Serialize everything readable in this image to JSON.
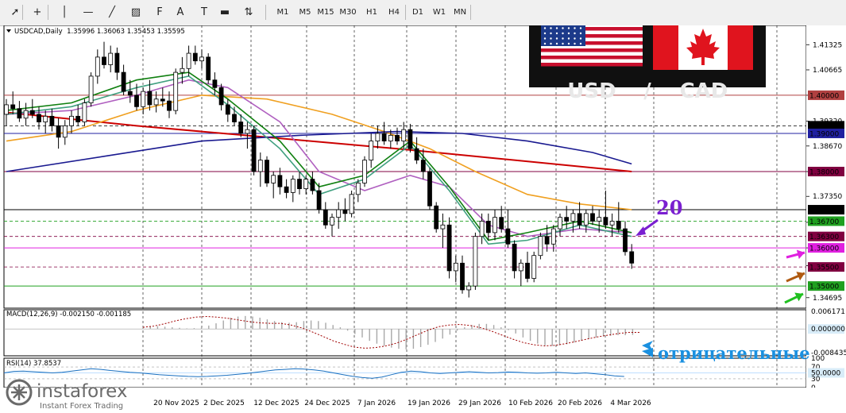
{
  "toolbar": {
    "tools": [
      {
        "name": "cursor-icon",
        "glyph": "➚"
      },
      {
        "name": "crosshair-icon",
        "glyph": "+"
      },
      {
        "name": "vertical-line-icon",
        "glyph": "│"
      },
      {
        "name": "horizontal-line-icon",
        "glyph": "—"
      },
      {
        "name": "trendline-icon",
        "glyph": "╱"
      },
      {
        "name": "channel-icon",
        "glyph": "▨"
      },
      {
        "name": "fibonacci-icon",
        "glyph": "F"
      },
      {
        "name": "text-icon",
        "glyph": "A"
      },
      {
        "name": "label-icon",
        "glyph": "T"
      },
      {
        "name": "rectangle-icon",
        "glyph": "▬"
      },
      {
        "name": "arrows-icon",
        "glyph": "⇅"
      }
    ],
    "timeframes": [
      "M1",
      "M5",
      "M15",
      "M30",
      "H1",
      "H4",
      "D1",
      "W1",
      "MN"
    ]
  },
  "symbol_info": "USDCAD,Daily  1.35996 1.36063 1.35453 1.35595",
  "flag_panel": {
    "left": "USD",
    "separator": "/",
    "right": "CAD"
  },
  "annotations": {
    "number": "20",
    "russian_text": "отрицательные"
  },
  "watermark": {
    "brand": "instaforex",
    "tagline": "Instant Forex Trading"
  },
  "colors": {
    "bull": "#ffffff",
    "bear": "#000000",
    "ma_red": "#cc0000",
    "ma_orange": "#f0a020",
    "ma_blue": "#1a1a90",
    "ma_violet": "#b060c0",
    "ma_green": "#108010",
    "ma_teal": "#40a080",
    "arrow_purple": "#7a1fd0",
    "arrow_magenta": "#e020e0",
    "arrow_brown": "#b05a10",
    "arrow_green": "#20c020",
    "arrow_blue": "#1a90e0"
  },
  "chart_data": {
    "type": "candlestick",
    "symbol": "USDCAD",
    "timeframe": "Daily",
    "ylim": [
      1.3442,
      1.4183
    ],
    "price_ticks": [
      "1.41325",
      "1.40665",
      "1.40000",
      "1.39320",
      "1.38670",
      "1.38000",
      "1.37350",
      "1.36670",
      "1.36000",
      "1.35535",
      "1.34695"
    ],
    "date_labels": [
      "20 Nov 2025",
      "2 Dec 2025",
      "12 Dec 2025",
      "24 Dec 2025",
      "7 Jan 2026",
      "19 Jan 2026",
      "29 Jan 2026",
      "10 Feb 2026",
      "20 Feb 2026",
      "4 Mar 2026"
    ],
    "levels": [
      {
        "value": 1.4,
        "label": "1.40000",
        "color": "#b04040",
        "style": "solid"
      },
      {
        "value": 1.392,
        "label": "1.39200",
        "color": "#000000",
        "style": "dash"
      },
      {
        "value": 1.39,
        "label": "1.39000",
        "color": "#2020a0",
        "style": "solid"
      },
      {
        "value": 1.38,
        "label": "1.38000",
        "color": "#800040",
        "style": "solid"
      },
      {
        "value": 1.37,
        "label": "1.37000",
        "color": "#000000",
        "style": "solid"
      },
      {
        "value": 1.367,
        "label": "1.36700",
        "color": "#20a020",
        "style": "dash"
      },
      {
        "value": 1.363,
        "label": "1.36300",
        "color": "#800040",
        "style": "dash"
      },
      {
        "value": 1.36,
        "label": "1.36000",
        "color": "#e020e0",
        "style": "solid"
      },
      {
        "value": 1.355,
        "label": "1.35500",
        "color": "#800040",
        "style": "dash"
      },
      {
        "value": 1.35,
        "label": "1.35000",
        "color": "#20a020",
        "style": "solid"
      }
    ],
    "candles": [
      [
        1.395,
        1.399,
        1.392,
        1.3975
      ],
      [
        1.3975,
        1.401,
        1.395,
        1.3965
      ],
      [
        1.3965,
        1.3985,
        1.393,
        1.394
      ],
      [
        1.394,
        1.398,
        1.392,
        1.396
      ],
      [
        1.396,
        1.399,
        1.394,
        1.395
      ],
      [
        1.395,
        1.397,
        1.391,
        1.393
      ],
      [
        1.393,
        1.396,
        1.39,
        1.3945
      ],
      [
        1.3945,
        1.3965,
        1.3905,
        1.392
      ],
      [
        1.392,
        1.394,
        1.386,
        1.389
      ],
      [
        1.389,
        1.3935,
        1.387,
        1.392
      ],
      [
        1.392,
        1.396,
        1.39,
        1.3945
      ],
      [
        1.3945,
        1.3975,
        1.392,
        1.393
      ],
      [
        1.393,
        1.399,
        1.392,
        1.398
      ],
      [
        1.398,
        1.406,
        1.397,
        1.405
      ],
      [
        1.405,
        1.412,
        1.403,
        1.41
      ],
      [
        1.41,
        1.414,
        1.407,
        1.408
      ],
      [
        1.408,
        1.413,
        1.406,
        1.411
      ],
      [
        1.411,
        1.4125,
        1.404,
        1.406
      ],
      [
        1.406,
        1.408,
        1.4,
        1.401
      ],
      [
        1.401,
        1.404,
        1.398,
        1.4
      ],
      [
        1.4,
        1.403,
        1.396,
        1.397
      ],
      [
        1.397,
        1.402,
        1.395,
        1.401
      ],
      [
        1.401,
        1.404,
        1.396,
        1.3975
      ],
      [
        1.3975,
        1.401,
        1.3955,
        1.399
      ],
      [
        1.399,
        1.402,
        1.397,
        1.3985
      ],
      [
        1.3985,
        1.401,
        1.394,
        1.396
      ],
      [
        1.396,
        1.407,
        1.395,
        1.406
      ],
      [
        1.406,
        1.41,
        1.403,
        1.407
      ],
      [
        1.407,
        1.413,
        1.405,
        1.411
      ],
      [
        1.411,
        1.413,
        1.408,
        1.409
      ],
      [
        1.409,
        1.412,
        1.407,
        1.41
      ],
      [
        1.41,
        1.411,
        1.403,
        1.404
      ],
      [
        1.404,
        1.406,
        1.4,
        1.402
      ],
      [
        1.402,
        1.403,
        1.396,
        1.3975
      ],
      [
        1.3975,
        1.399,
        1.393,
        1.395
      ],
      [
        1.395,
        1.397,
        1.392,
        1.393
      ],
      [
        1.393,
        1.395,
        1.389,
        1.39
      ],
      [
        1.39,
        1.393,
        1.386,
        1.391
      ],
      [
        1.391,
        1.392,
        1.379,
        1.38
      ],
      [
        1.38,
        1.385,
        1.376,
        1.383
      ],
      [
        1.383,
        1.384,
        1.376,
        1.377
      ],
      [
        1.377,
        1.38,
        1.373,
        1.379
      ],
      [
        1.379,
        1.381,
        1.374,
        1.376
      ],
      [
        1.376,
        1.378,
        1.373,
        1.3745
      ],
      [
        1.3745,
        1.379,
        1.372,
        1.378
      ],
      [
        1.378,
        1.38,
        1.374,
        1.3755
      ],
      [
        1.3755,
        1.379,
        1.374,
        1.378
      ],
      [
        1.378,
        1.38,
        1.374,
        1.375
      ],
      [
        1.375,
        1.377,
        1.369,
        1.37
      ],
      [
        1.37,
        1.372,
        1.365,
        1.366
      ],
      [
        1.366,
        1.369,
        1.363,
        1.368
      ],
      [
        1.368,
        1.372,
        1.365,
        1.37
      ],
      [
        1.37,
        1.373,
        1.367,
        1.369
      ],
      [
        1.369,
        1.375,
        1.368,
        1.374
      ],
      [
        1.374,
        1.378,
        1.372,
        1.377
      ],
      [
        1.377,
        1.384,
        1.376,
        1.383
      ],
      [
        1.383,
        1.39,
        1.381,
        1.388
      ],
      [
        1.388,
        1.392,
        1.386,
        1.39
      ],
      [
        1.39,
        1.393,
        1.387,
        1.388
      ],
      [
        1.388,
        1.391,
        1.386,
        1.3895
      ],
      [
        1.3895,
        1.3915,
        1.387,
        1.388
      ],
      [
        1.388,
        1.393,
        1.386,
        1.391
      ],
      [
        1.391,
        1.3925,
        1.385,
        1.386
      ],
      [
        1.386,
        1.389,
        1.382,
        1.383
      ],
      [
        1.383,
        1.386,
        1.378,
        1.38
      ],
      [
        1.38,
        1.381,
        1.37,
        1.371
      ],
      [
        1.371,
        1.372,
        1.364,
        1.365
      ],
      [
        1.365,
        1.369,
        1.36,
        1.366
      ],
      [
        1.366,
        1.368,
        1.352,
        1.354
      ],
      [
        1.354,
        1.358,
        1.351,
        1.356
      ],
      [
        1.356,
        1.358,
        1.348,
        1.349
      ],
      [
        1.349,
        1.351,
        1.347,
        1.35
      ],
      [
        1.35,
        1.364,
        1.349,
        1.363
      ],
      [
        1.363,
        1.369,
        1.361,
        1.367
      ],
      [
        1.367,
        1.369,
        1.362,
        1.364
      ],
      [
        1.364,
        1.37,
        1.362,
        1.368
      ],
      [
        1.368,
        1.371,
        1.364,
        1.365
      ],
      [
        1.365,
        1.37,
        1.36,
        1.361
      ],
      [
        1.361,
        1.362,
        1.352,
        1.354
      ],
      [
        1.354,
        1.357,
        1.35,
        1.356
      ],
      [
        1.356,
        1.359,
        1.351,
        1.352
      ],
      [
        1.352,
        1.359,
        1.351,
        1.358
      ],
      [
        1.358,
        1.364,
        1.357,
        1.363
      ],
      [
        1.363,
        1.366,
        1.359,
        1.361
      ],
      [
        1.361,
        1.366,
        1.359,
        1.365
      ],
      [
        1.365,
        1.369,
        1.363,
        1.368
      ],
      [
        1.368,
        1.371,
        1.365,
        1.367
      ],
      [
        1.367,
        1.37,
        1.364,
        1.369
      ],
      [
        1.369,
        1.372,
        1.365,
        1.366
      ],
      [
        1.366,
        1.37,
        1.364,
        1.369
      ],
      [
        1.369,
        1.371,
        1.366,
        1.367
      ],
      [
        1.367,
        1.37,
        1.364,
        1.368
      ],
      [
        1.368,
        1.375,
        1.365,
        1.366
      ],
      [
        1.366,
        1.369,
        1.363,
        1.367
      ],
      [
        1.367,
        1.372,
        1.364,
        1.365
      ],
      [
        1.365,
        1.367,
        1.358,
        1.359
      ],
      [
        1.359,
        1.361,
        1.3545,
        1.356
      ]
    ],
    "moving_averages": [
      {
        "name": "red",
        "color": "#cc0000",
        "points": [
          [
            0,
            1.3955
          ],
          [
            20,
            1.392
          ],
          [
            40,
            1.389
          ],
          [
            60,
            1.386
          ],
          [
            75,
            1.3835
          ],
          [
            90,
            1.381
          ],
          [
            96,
            1.38
          ]
        ]
      },
      {
        "name": "orange",
        "color": "#f0a020",
        "points": [
          [
            0,
            1.388
          ],
          [
            10,
            1.3905
          ],
          [
            20,
            1.396
          ],
          [
            30,
            1.4
          ],
          [
            40,
            1.399
          ],
          [
            50,
            1.395
          ],
          [
            58,
            1.3905
          ],
          [
            65,
            1.386
          ],
          [
            72,
            1.38
          ],
          [
            80,
            1.374
          ],
          [
            88,
            1.3715
          ],
          [
            96,
            1.37
          ]
        ]
      },
      {
        "name": "blue",
        "color": "#1a1a90",
        "points": [
          [
            0,
            1.38
          ],
          [
            15,
            1.384
          ],
          [
            30,
            1.388
          ],
          [
            45,
            1.3895
          ],
          [
            60,
            1.3905
          ],
          [
            70,
            1.39
          ],
          [
            80,
            1.388
          ],
          [
            90,
            1.385
          ],
          [
            96,
            1.382
          ]
        ]
      },
      {
        "name": "violet",
        "color": "#b060c0",
        "points": [
          [
            0,
            1.395
          ],
          [
            10,
            1.396
          ],
          [
            20,
            1.4
          ],
          [
            28,
            1.404
          ],
          [
            34,
            1.402
          ],
          [
            42,
            1.393
          ],
          [
            48,
            1.38
          ],
          [
            55,
            1.375
          ],
          [
            62,
            1.379
          ],
          [
            68,
            1.376
          ],
          [
            74,
            1.366
          ],
          [
            80,
            1.363
          ],
          [
            88,
            1.365
          ],
          [
            96,
            1.364
          ]
        ]
      },
      {
        "name": "green",
        "color": "#108010",
        "points": [
          [
            0,
            1.396
          ],
          [
            10,
            1.398
          ],
          [
            20,
            1.404
          ],
          [
            28,
            1.406
          ],
          [
            34,
            1.399
          ],
          [
            42,
            1.388
          ],
          [
            48,
            1.376
          ],
          [
            55,
            1.379
          ],
          [
            62,
            1.388
          ],
          [
            68,
            1.376
          ],
          [
            74,
            1.362
          ],
          [
            80,
            1.364
          ],
          [
            88,
            1.367
          ],
          [
            96,
            1.364
          ]
        ]
      },
      {
        "name": "teal",
        "color": "#40a080",
        "points": [
          [
            0,
            1.395
          ],
          [
            10,
            1.397
          ],
          [
            20,
            1.402
          ],
          [
            28,
            1.405
          ],
          [
            34,
            1.3975
          ],
          [
            42,
            1.386
          ],
          [
            48,
            1.374
          ],
          [
            55,
            1.378
          ],
          [
            62,
            1.387
          ],
          [
            68,
            1.375
          ],
          [
            74,
            1.361
          ],
          [
            80,
            1.362
          ],
          [
            88,
            1.366
          ],
          [
            96,
            1.363
          ]
        ]
      }
    ],
    "macd": {
      "label": "MACD(12,26,9) -0.002150 -0.001185",
      "ticks": [
        "0.006171",
        "0.000000",
        "-0.008435"
      ],
      "ylim": [
        -0.0095,
        0.0068
      ],
      "histogram": [
        0.0008,
        0.001,
        0.001,
        0.0008,
        0.0006,
        0.0004,
        0.0002,
        0.0003,
        0.0006,
        0.0012,
        0.002,
        0.003,
        0.004,
        0.0044,
        0.0046,
        0.0044,
        0.004,
        0.0034,
        0.0028,
        0.0024,
        0.0022,
        0.0024,
        0.0028,
        0.003,
        0.0028,
        0.0022,
        0.0014,
        0.0006,
        -0.0006,
        -0.0018,
        -0.003,
        -0.0042,
        -0.0052,
        -0.006,
        -0.0066,
        -0.007,
        -0.0072,
        -0.007,
        -0.0064,
        -0.0056,
        -0.0046,
        -0.0034,
        -0.002,
        -0.0006,
        0.0006,
        0.0014,
        0.0018,
        0.0018,
        0.0014,
        0.0006,
        -0.0004,
        -0.0016,
        -0.003,
        -0.0042,
        -0.0052,
        -0.0058,
        -0.006,
        -0.0058,
        -0.0054,
        -0.0048,
        -0.0042,
        -0.0036,
        -0.003,
        -0.0026,
        -0.0024,
        -0.0022,
        -0.0022,
        -0.0021
      ],
      "signal": [
        0.0006,
        0.001,
        0.0018,
        0.0028,
        0.0036,
        0.0042,
        0.0044,
        0.0042,
        0.0038,
        0.0032,
        0.0026,
        0.0022,
        0.002,
        0.002,
        0.0014,
        0.0004,
        -0.001,
        -0.0026,
        -0.0042,
        -0.0054,
        -0.0064,
        -0.0068,
        -0.0066,
        -0.006,
        -0.005,
        -0.0036,
        -0.002,
        -0.0004,
        0.0008,
        0.0014,
        0.0016,
        0.0012,
        0.0004,
        -0.0008,
        -0.0022,
        -0.0036,
        -0.0048,
        -0.0056,
        -0.006,
        -0.0058,
        -0.0052,
        -0.0044,
        -0.0036,
        -0.0028,
        -0.0022,
        -0.0016,
        -0.0012,
        -0.0012
      ]
    },
    "rsi": {
      "label": "RSI(14) 37.8537",
      "ticks": [
        "100",
        "70",
        "50.0000",
        "30",
        "0"
      ],
      "ylim": [
        0,
        100
      ],
      "values": [
        50,
        55,
        56,
        54,
        52,
        50,
        52,
        56,
        60,
        64,
        62,
        58,
        55,
        52,
        50,
        47,
        44,
        42,
        40,
        38,
        37,
        38,
        40,
        42,
        45,
        48,
        52,
        56,
        60,
        62,
        64,
        63,
        60,
        56,
        50,
        44,
        38,
        34,
        32,
        36,
        44,
        52,
        56,
        54,
        50,
        48,
        50,
        52,
        54,
        52,
        50,
        51,
        53,
        52,
        50,
        49,
        50,
        52,
        50,
        48,
        50,
        47,
        44,
        40,
        37.8537
      ]
    }
  }
}
